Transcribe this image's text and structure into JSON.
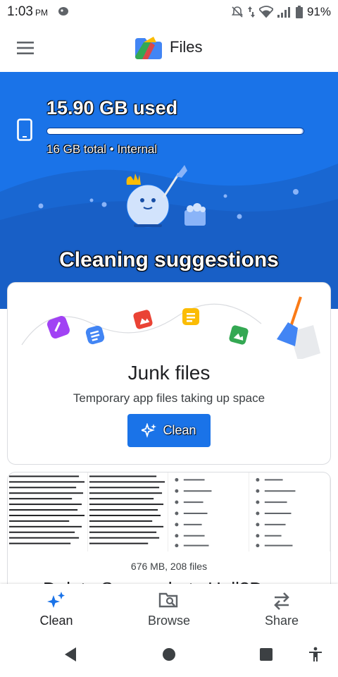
{
  "status_bar": {
    "time": "1:03",
    "ampm": "PM",
    "battery": "91%"
  },
  "app_bar": {
    "title": "Files"
  },
  "storage": {
    "used": "15.90 GB used",
    "info": "16 GB total • Internal",
    "fraction_used": 0.994
  },
  "section_heading": "Cleaning suggestions",
  "junk_card": {
    "title": "Junk files",
    "description": "Temporary app files taking up space",
    "button_label": "Clean"
  },
  "screenshots_card": {
    "meta": "676 MB, 208 files",
    "title": "Delete Screenshots Hell?D"
  },
  "bottom_nav": {
    "items": [
      {
        "label": "Clean",
        "icon": "sparkle-icon"
      },
      {
        "label": "Browse",
        "icon": "browse-icon"
      },
      {
        "label": "Share",
        "icon": "share-arrows-icon"
      }
    ]
  },
  "colors": {
    "primary": "#1a73e8",
    "surface": "#ffffff"
  }
}
